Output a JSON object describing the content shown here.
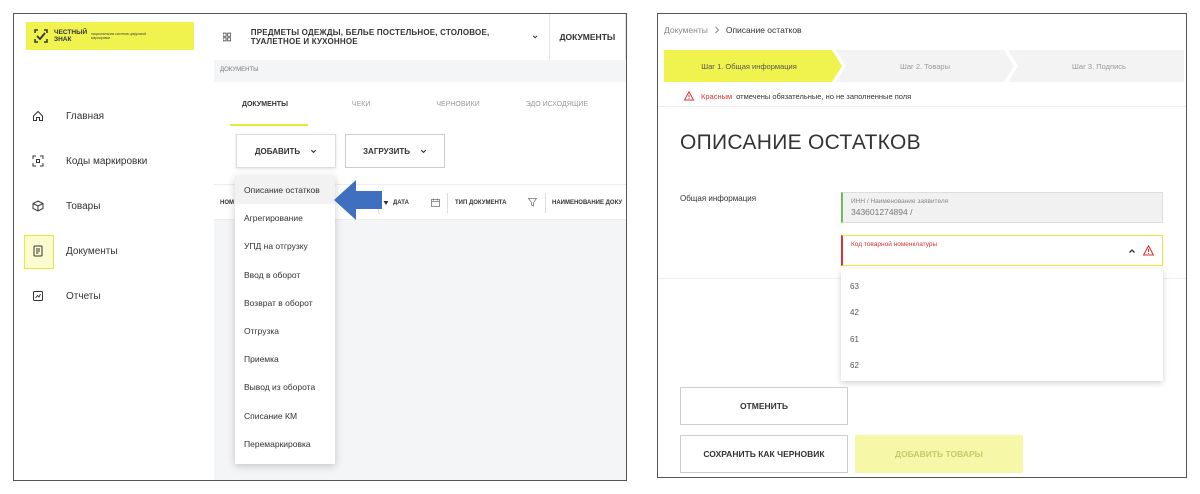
{
  "left": {
    "logo": {
      "main": "ЧЕСТНЫЙ ЗНАК",
      "sub": "национальная система цифровой маркировки"
    },
    "topbar": {
      "category": "ПРЕДМЕТЫ ОДЕЖДЫ, БЕЛЬЕ ПОСТЕЛЬНОЕ, СТОЛОВОЕ, ТУАЛЕТНОЕ И КУХОННОЕ",
      "docs": "ДОКУМЕНТЫ"
    },
    "nav": [
      {
        "label": "Главная",
        "icon": "home-icon"
      },
      {
        "label": "Коды маркировки",
        "icon": "qr-scan-icon"
      },
      {
        "label": "Товары",
        "icon": "box-icon"
      },
      {
        "label": "Документы",
        "icon": "document-icon",
        "active": true
      },
      {
        "label": "Отчеты",
        "icon": "report-icon"
      }
    ],
    "breadcrumb": "ДОКУМЕНТЫ",
    "tabs": [
      "ДОКУМЕНТЫ",
      "ЧЕКИ",
      "ЧЕРНОВИКИ",
      "ЭДО ИСХОДЯЩИЕ"
    ],
    "buttons": {
      "add": "ДОБАВИТЬ",
      "upload": "ЗАГРУЗИТЬ"
    },
    "table_headers": [
      "НОМ",
      "ДАТА",
      "ТИП ДОКУМЕНТА",
      "НАИМЕНОВАНИЕ ДОКУ"
    ],
    "dropdown": [
      "Описание остатков",
      "Агрегирование",
      "УПД на отгрузку",
      "Ввод в оборот",
      "Возврат в оборот",
      "Отгрузка",
      "Приемка",
      "Вывод из оборота",
      "Списание КМ",
      "Перемаркировка"
    ]
  },
  "right": {
    "breadcrumb": {
      "parent": "Документы",
      "current": "Описание остатков"
    },
    "steps": [
      "Шаг 1. Общая информация",
      "Шаг 2. Товары",
      "Шаг 3. Подпись"
    ],
    "warning": {
      "red": "Красным",
      "rest": "отмечены обязательные, но не заполненные поля"
    },
    "title": "ОПИСАНИЕ ОСТАТКОВ",
    "section": "Общая информация",
    "inn_field": {
      "label": "ИНН / Наименование заявителя",
      "value": "343601274894 /"
    },
    "code_field": {
      "label": "Код товарной номенклатуры"
    },
    "code_options": [
      "63",
      "42",
      "61",
      "62"
    ],
    "buttons": {
      "cancel": "ОТМЕНИТЬ",
      "draft": "СОХРАНИТЬ КАК ЧЕРНОВИК",
      "add_goods": "ДОБАВИТЬ ТОВАРЫ"
    }
  },
  "colors": {
    "accent": "#f0f34d",
    "arrow": "#3f6fbf",
    "required": "#dd3333",
    "ok": "#6bbf59"
  }
}
